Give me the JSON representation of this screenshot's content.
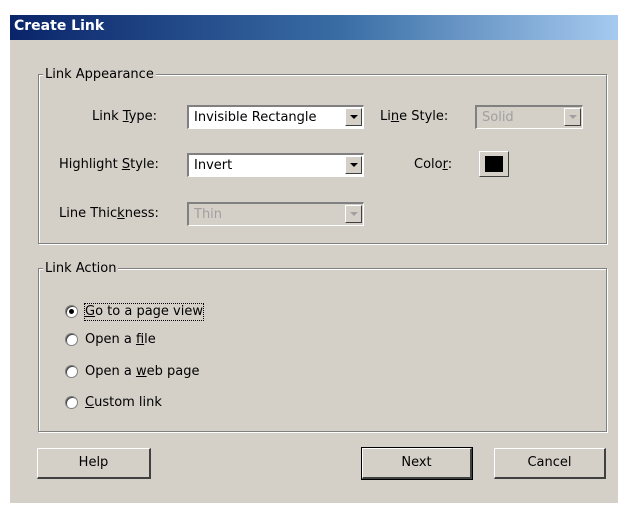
{
  "window": {
    "title": "Create Link"
  },
  "appearance": {
    "group_label": "Link Appearance",
    "link_type": {
      "pre": "Link ",
      "accel": "T",
      "post": "ype:",
      "value": "Invisible Rectangle"
    },
    "line_style": {
      "pre": "Li",
      "accel": "n",
      "post": "e Style:",
      "value": "Solid"
    },
    "highlight_style": {
      "pre": "Highlight ",
      "accel": "S",
      "post": "tyle:",
      "value": "Invert"
    },
    "color": {
      "pre": "Colo",
      "accel": "r",
      "post": ":",
      "swatch_color": "#000000"
    },
    "line_thickness": {
      "pre": "Line Thic",
      "accel": "k",
      "post": "ness:",
      "value": "Thin"
    }
  },
  "action": {
    "group_label": "Link Action",
    "options": [
      {
        "pre": "",
        "accel": "G",
        "post": "o to a page view",
        "selected": true
      },
      {
        "pre": "Open a ",
        "accel": "f",
        "post": "ile",
        "selected": false
      },
      {
        "pre": "Open a ",
        "accel": "w",
        "post": "eb page",
        "selected": false
      },
      {
        "pre": "",
        "accel": "C",
        "post": "ustom link",
        "selected": false
      }
    ]
  },
  "buttons": {
    "help": "Help",
    "next": "Next",
    "cancel": "Cancel"
  }
}
